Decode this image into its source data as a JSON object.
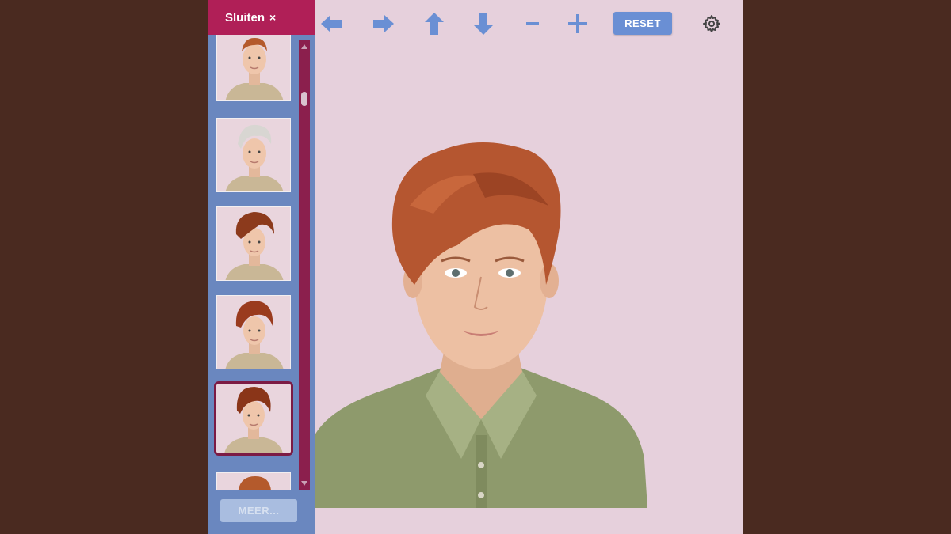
{
  "sidebar": {
    "close_label": "Sluiten",
    "close_icon": "×",
    "more_label": "MEER...",
    "thumbnails": [
      {
        "hair": "copper-short"
      },
      {
        "hair": "platinum-short"
      },
      {
        "hair": "auburn-pixie"
      },
      {
        "hair": "auburn-side-swept"
      },
      {
        "hair": "auburn-pixie-selected",
        "selected": true
      },
      {
        "hair": "copper-partial"
      }
    ]
  },
  "toolbar": {
    "icons": [
      "arrow-left-icon",
      "arrow-right-icon",
      "arrow-up-icon",
      "arrow-down-icon",
      "zoom-out-icon",
      "zoom-in-icon"
    ],
    "reset_label": "RESET",
    "settings_icon": "gear-icon"
  },
  "colors": {
    "background": "#4a2a20",
    "canvas": "#e6d0dc",
    "sidebar": "#6a87bf",
    "accent": "#b01f57",
    "toolbar_icon": "#6a8fd4"
  }
}
